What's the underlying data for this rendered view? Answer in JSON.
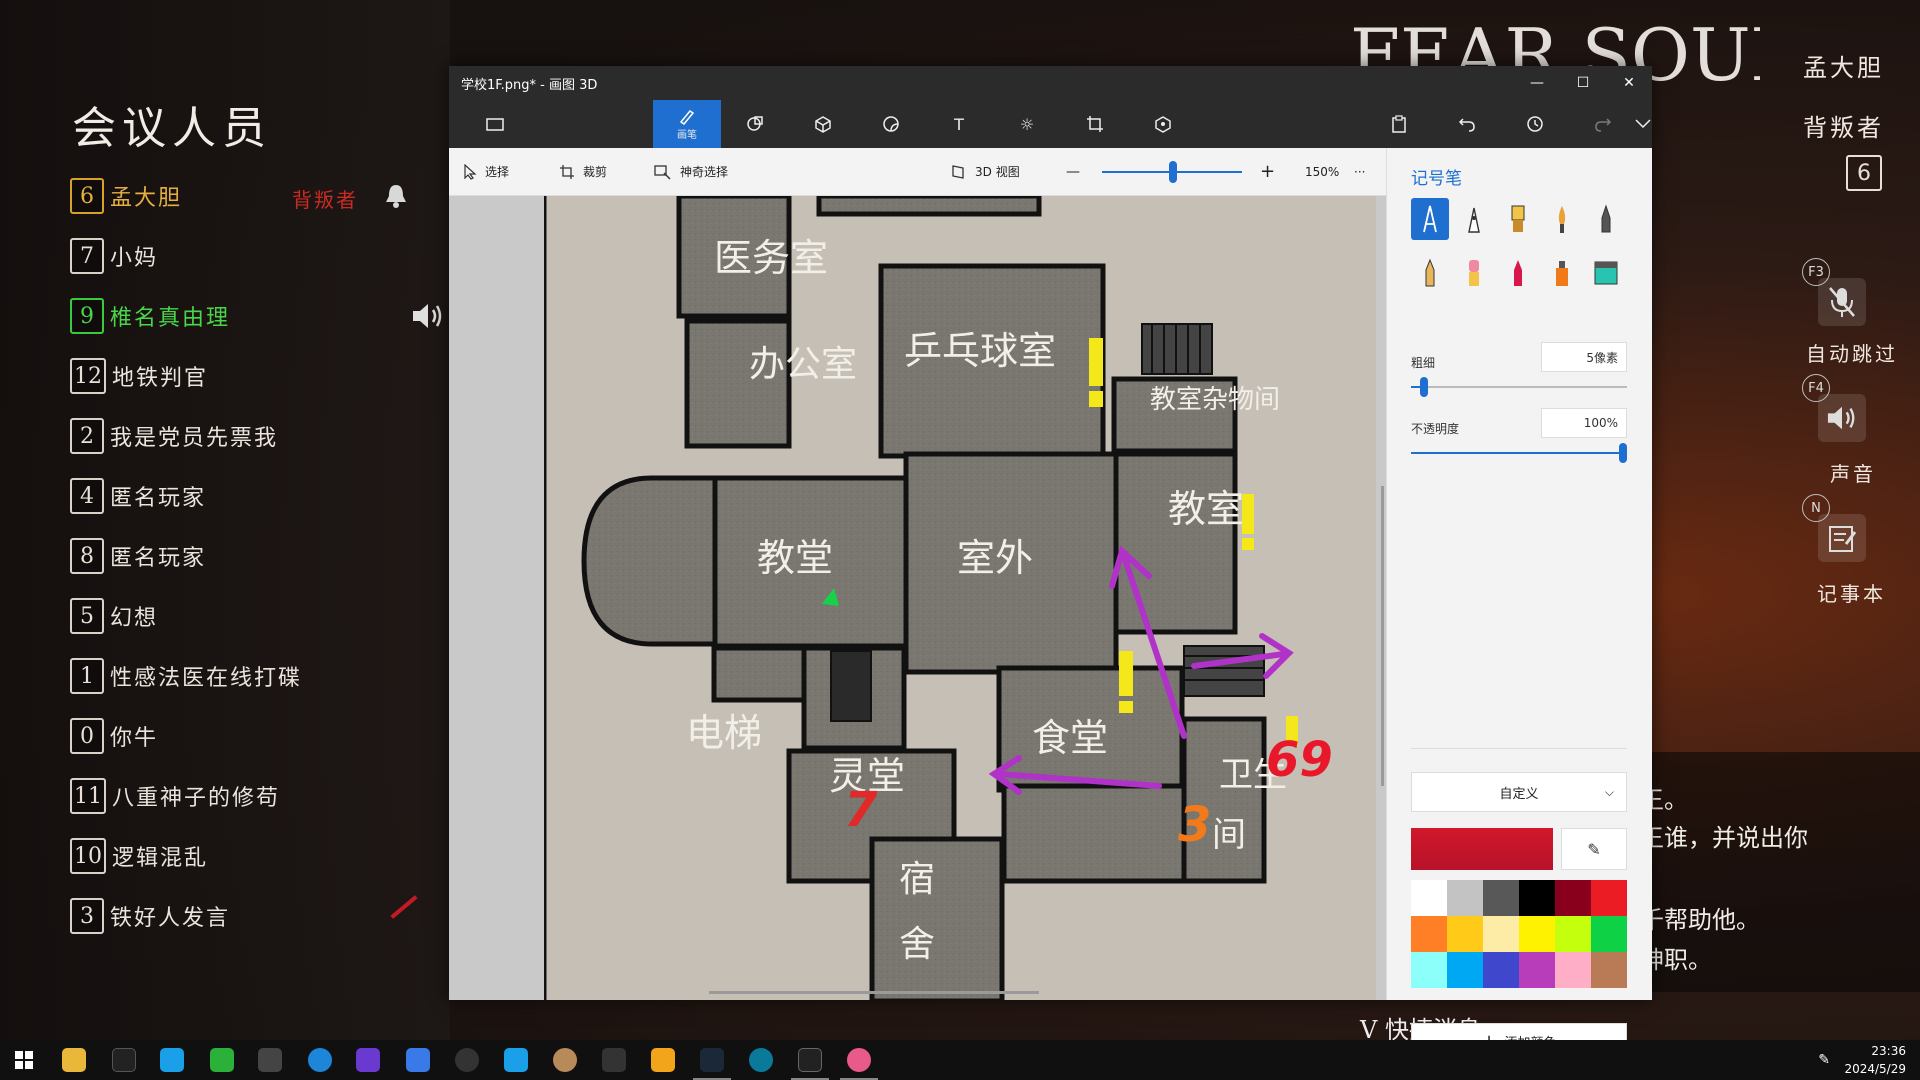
{
  "game": {
    "meeting_title": "会议人员",
    "players": [
      {
        "num": "6",
        "name": "孟大胆",
        "style": "gold"
      },
      {
        "num": "7",
        "name": "小妈",
        "style": "normal"
      },
      {
        "num": "9",
        "name": "椎名真由理",
        "style": "green"
      },
      {
        "num": "12",
        "name": "地铁判官",
        "style": "normal"
      },
      {
        "num": "2",
        "name": "我是党员先票我",
        "style": "normal"
      },
      {
        "num": "4",
        "name": "匿名玩家",
        "style": "normal"
      },
      {
        "num": "8",
        "name": "匿名玩家",
        "style": "normal"
      },
      {
        "num": "5",
        "name": "幻想",
        "style": "normal"
      },
      {
        "num": "1",
        "name": "性感法医在线打碟",
        "style": "normal"
      },
      {
        "num": "0",
        "name": "你牛",
        "style": "normal"
      },
      {
        "num": "11",
        "name": "八重神子的修苟",
        "style": "normal"
      },
      {
        "num": "10",
        "name": "逻辑混乱",
        "style": "normal"
      },
      {
        "num": "3",
        "name": "铁好人发言",
        "style": "normal"
      }
    ],
    "traitor_tag": "背叛者",
    "logo_text": "FEAR SOUNDS",
    "hud": {
      "player_name": "孟大胆",
      "role": "背叛者",
      "number": "6",
      "key_f3": "F3",
      "auto_skip": "自动跳过",
      "key_f4": "F4",
      "sound": "声音",
      "key_n": "N",
      "notepad": "记事本"
    },
    "chat_lines": [
      "王。",
      "王谁，并说出你",
      "千帮助他。",
      "神职。"
    ],
    "quick_message": "V 快捷消息"
  },
  "window": {
    "title": "学校1F.png* - 画图 3D",
    "controls": [
      "—",
      "☐",
      "✕"
    ],
    "tools": [
      {
        "label": "画笔",
        "icon": "brush-icon"
      },
      {
        "label": "",
        "icon": "2d-shapes-icon"
      },
      {
        "label": "",
        "icon": "3d-shapes-icon"
      },
      {
        "label": "",
        "icon": "stickers-icon"
      },
      {
        "label": "T",
        "icon": "text-icon"
      },
      {
        "label": "☼",
        "icon": "effects-icon"
      },
      {
        "label": "",
        "icon": "canvas-icon"
      },
      {
        "label": "",
        "icon": "3d-library-icon"
      }
    ],
    "subbar": {
      "select": "选择",
      "crop": "裁剪",
      "magic_select": "神奇选择",
      "view_3d": "3D 视图",
      "zoom_out": "—",
      "zoom_in": "+",
      "zoom": "150%",
      "more": "···"
    },
    "panel": {
      "title": "记号笔",
      "thickness_label": "粗细",
      "thickness_value": "5像素",
      "thickness_level": 0.04,
      "opacity_label": "不透明度",
      "opacity_value": "100%",
      "opacity_level": 1.0,
      "dropdown": "自定义",
      "current_color": "#d0182a",
      "add_color": "添加颜色",
      "swatches": [
        "#ffffff",
        "#c3c3c3",
        "#585858",
        "#000000",
        "#88001b",
        "#ec1c24",
        "#ff7f27",
        "#ffca18",
        "#fdeca6",
        "#fff200",
        "#c4ff0e",
        "#0ed145",
        "#8cfffb",
        "#00a8f3",
        "#3f48cc",
        "#b83dba",
        "#ffaec8",
        "#b97a56"
      ]
    }
  },
  "map": {
    "rooms": {
      "infirmary": "医务室",
      "office": "办公室",
      "pingpong": "乒乓球室",
      "storage": "教室杂物间",
      "classroom": "教室",
      "chapel": "教堂",
      "outdoor": "室外",
      "elevator": "电梯",
      "mourning": "灵堂",
      "canteen": "食堂",
      "restroom_a": "卫生",
      "restroom_b": "间",
      "dorm_a": "宿",
      "dorm_b": "舍"
    },
    "marks": {
      "red_7": "7",
      "orange_3": "3",
      "red_69": "69"
    }
  },
  "taskbar": {
    "time": "23:36",
    "date": "2024/5/29"
  }
}
